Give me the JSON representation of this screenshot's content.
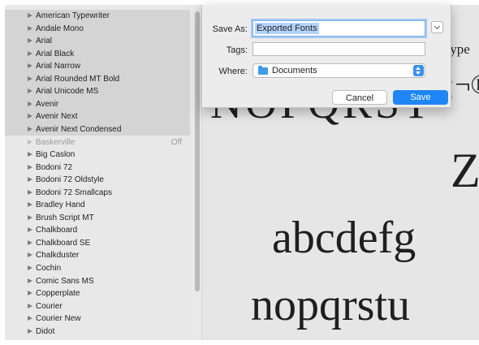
{
  "font_list": {
    "fonts": [
      {
        "name": "American Typewriter",
        "selected": true
      },
      {
        "name": "Andale Mono",
        "selected": true
      },
      {
        "name": "Arial",
        "selected": true
      },
      {
        "name": "Arial Black",
        "selected": true
      },
      {
        "name": "Arial Narrow",
        "selected": true
      },
      {
        "name": "Arial Rounded MT Bold",
        "selected": true
      },
      {
        "name": "Arial Unicode MS",
        "selected": true
      },
      {
        "name": "Avenir",
        "selected": true
      },
      {
        "name": "Avenir Next",
        "selected": true
      },
      {
        "name": "Avenir Next Condensed",
        "selected": true
      },
      {
        "name": "Baskerville",
        "selected": false,
        "disabled": true,
        "status": "Off"
      },
      {
        "name": "Big Caslon",
        "selected": false
      },
      {
        "name": "Bodoni 72",
        "selected": false
      },
      {
        "name": "Bodoni 72 Oldstyle",
        "selected": false
      },
      {
        "name": "Bodoni 72 Smallcaps",
        "selected": false
      },
      {
        "name": "Bradley Hand",
        "selected": false
      },
      {
        "name": "Brush Script MT",
        "selected": false
      },
      {
        "name": "Chalkboard",
        "selected": false
      },
      {
        "name": "Chalkboard SE",
        "selected": false
      },
      {
        "name": "Chalkduster",
        "selected": false
      },
      {
        "name": "Cochin",
        "selected": false
      },
      {
        "name": "Comic Sans MS",
        "selected": false
      },
      {
        "name": "Copperplate",
        "selected": false
      },
      {
        "name": "Courier",
        "selected": false
      },
      {
        "name": "Courier New",
        "selected": false
      },
      {
        "name": "Didot",
        "selected": false
      }
    ]
  },
  "preview": {
    "type_fragment": "Type",
    "glyph_fragment": "¡¬®",
    "uppercase_text": "NOPQRST",
    "single_upper": "Z",
    "lowercase_line1": "abcdefg",
    "lowercase_line2": "nopqrstu"
  },
  "save_dialog": {
    "save_as_label": "Save As:",
    "save_as_value": "Exported Fonts",
    "tags_label": "Tags:",
    "tags_value": "",
    "where_label": "Where:",
    "where_value": "Documents",
    "cancel_label": "Cancel",
    "save_label": "Save",
    "icons": {
      "expand": "chevron-down-icon",
      "folder": "folder-icon",
      "popup": "up-down-arrows-icon"
    },
    "colors": {
      "save_button": "#1f86f5",
      "selection": "#b3d3fb",
      "folder": "#3f9be6"
    }
  }
}
